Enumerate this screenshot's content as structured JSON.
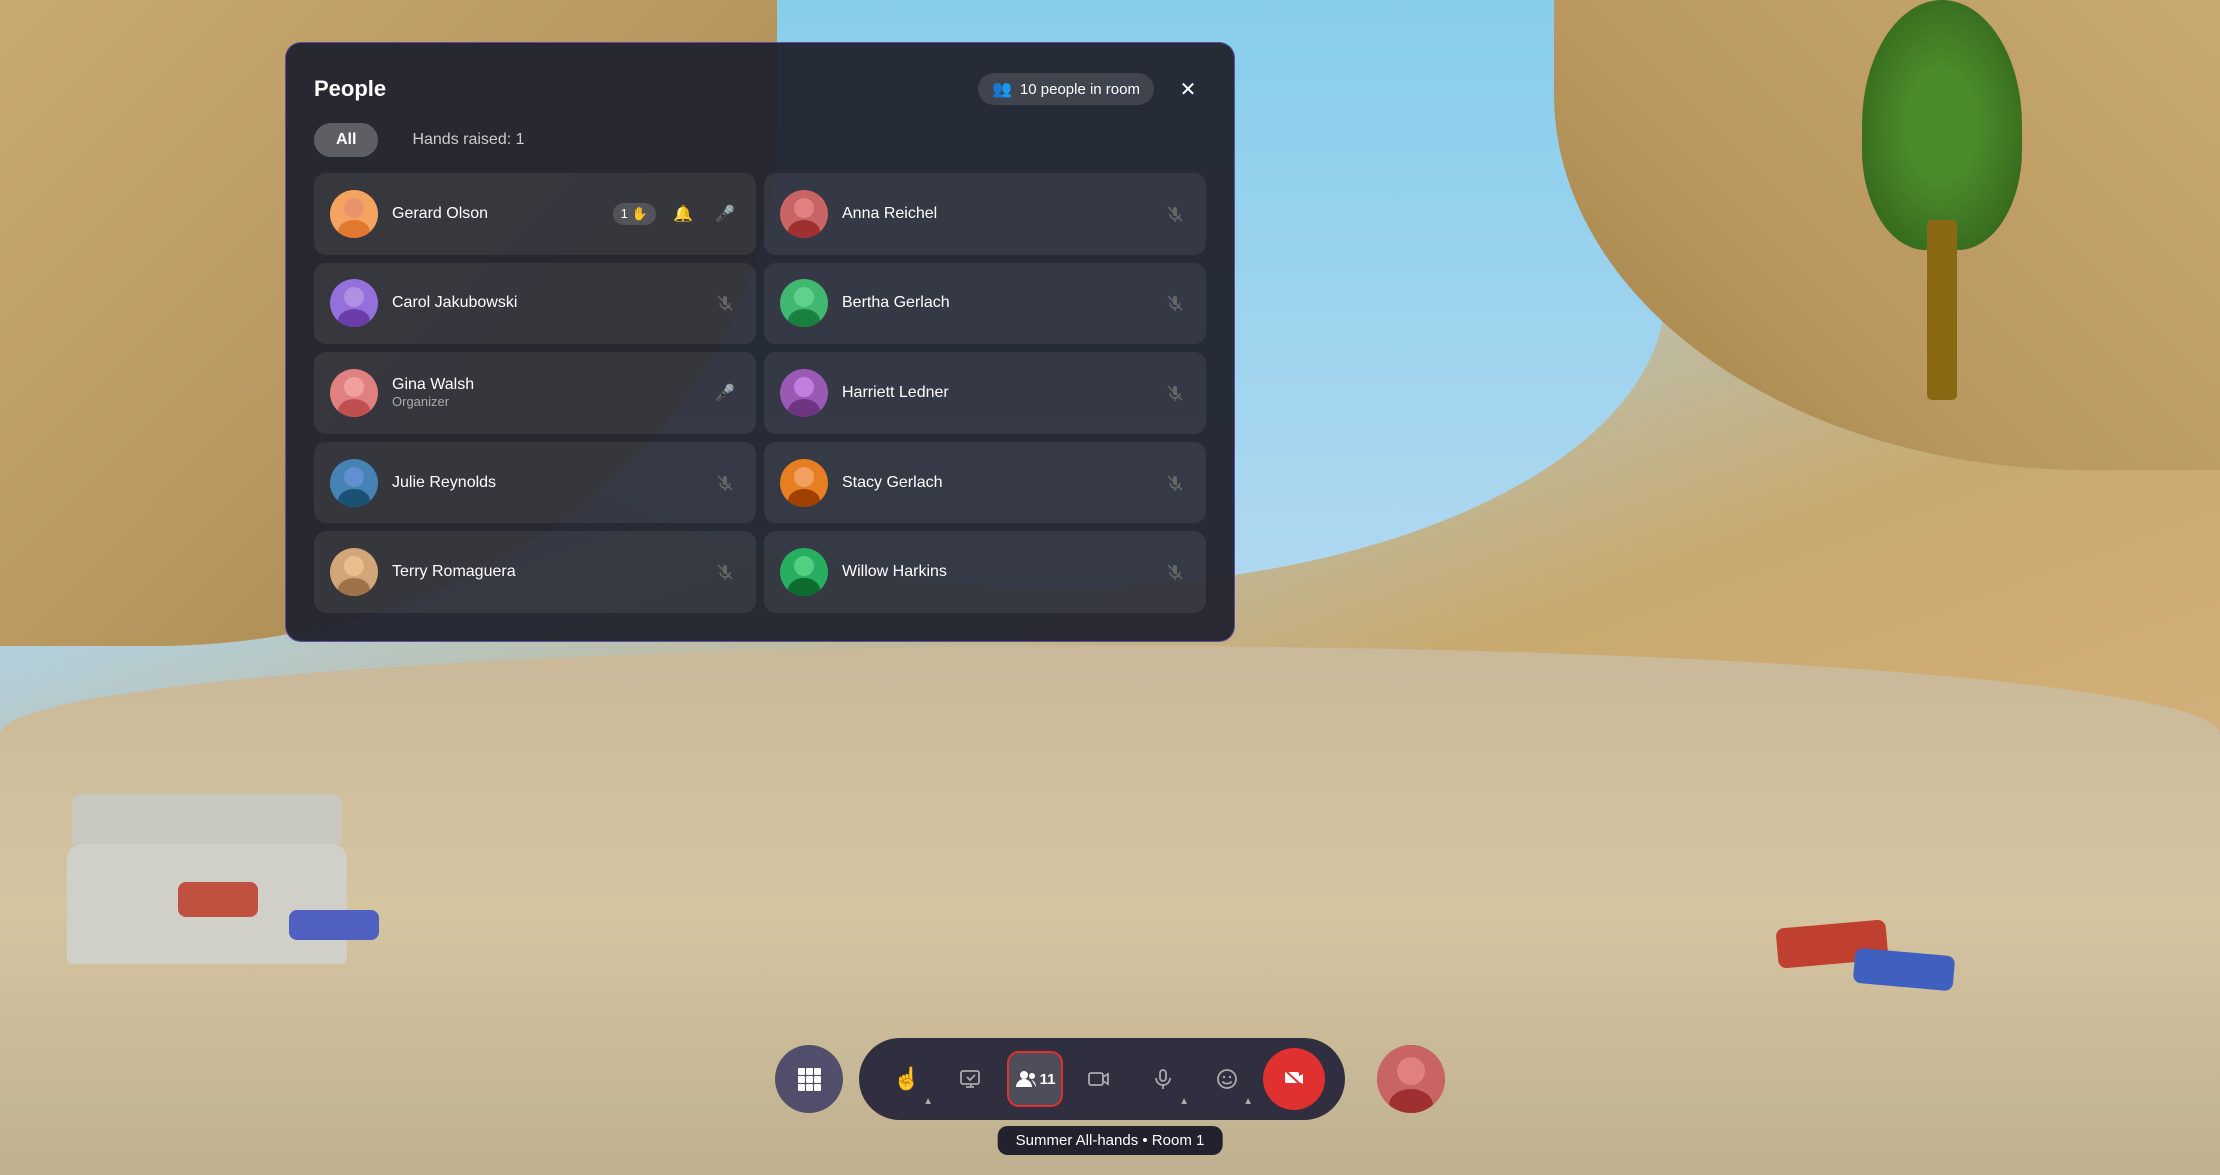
{
  "background": {
    "colors": {
      "sky": "#87ceeb",
      "ceiling": "#c8a96e",
      "floor": "#c9b99a"
    }
  },
  "panel": {
    "title": "People",
    "people_count": "10 people in room",
    "close_label": "✕",
    "filter_all": "All",
    "filter_hands": "Hands raised: 1",
    "people": [
      {
        "id": "gerard",
        "name": "Gerard Olson",
        "role": "",
        "hand_raised": true,
        "hand_count": "1",
        "mic": "on",
        "avatar_class": "avatar-gerard",
        "avatar_emoji": "🧑"
      },
      {
        "id": "anna",
        "name": "Anna Reichel",
        "role": "",
        "hand_raised": false,
        "mic": "off",
        "avatar_class": "avatar-anna",
        "avatar_emoji": "👩"
      },
      {
        "id": "carol",
        "name": "Carol Jakubowski",
        "role": "",
        "hand_raised": false,
        "mic": "off",
        "avatar_class": "avatar-carol",
        "avatar_emoji": "🧕"
      },
      {
        "id": "bertha",
        "name": "Bertha Gerlach",
        "role": "",
        "hand_raised": false,
        "mic": "off",
        "avatar_class": "avatar-bertha",
        "avatar_emoji": "👒"
      },
      {
        "id": "gina",
        "name": "Gina Walsh",
        "role": "Organizer",
        "hand_raised": false,
        "mic": "on",
        "avatar_class": "avatar-gina",
        "avatar_emoji": "👩"
      },
      {
        "id": "harriett",
        "name": "Harriett Ledner",
        "role": "",
        "hand_raised": false,
        "mic": "off",
        "avatar_class": "avatar-harriett",
        "avatar_emoji": "👱"
      },
      {
        "id": "julie",
        "name": "Julie Reynolds",
        "role": "",
        "hand_raised": false,
        "mic": "off",
        "avatar_class": "avatar-julie",
        "avatar_emoji": "👩"
      },
      {
        "id": "stacy",
        "name": "Stacy Gerlach",
        "role": "",
        "hand_raised": false,
        "mic": "off",
        "avatar_class": "avatar-stacy",
        "avatar_emoji": "👩"
      },
      {
        "id": "terry",
        "name": "Terry Romaguera",
        "role": "",
        "hand_raised": false,
        "mic": "off",
        "avatar_class": "avatar-terry",
        "avatar_emoji": "🧔"
      },
      {
        "id": "willow",
        "name": "Willow Harkins",
        "role": "",
        "hand_raised": false,
        "mic": "off",
        "avatar_class": "avatar-willow",
        "avatar_emoji": "👩"
      }
    ]
  },
  "toolbar": {
    "grid_btn_icon": "⊞",
    "raise_hand_icon": "↑",
    "present_icon": "▶",
    "people_icon": "👤",
    "people_count": "11",
    "camera_icon": "📷",
    "mic_icon": "🎤",
    "emoji_icon": "😊",
    "end_icon": "📋",
    "tooltip": "Summer All-hands • Room 1"
  }
}
